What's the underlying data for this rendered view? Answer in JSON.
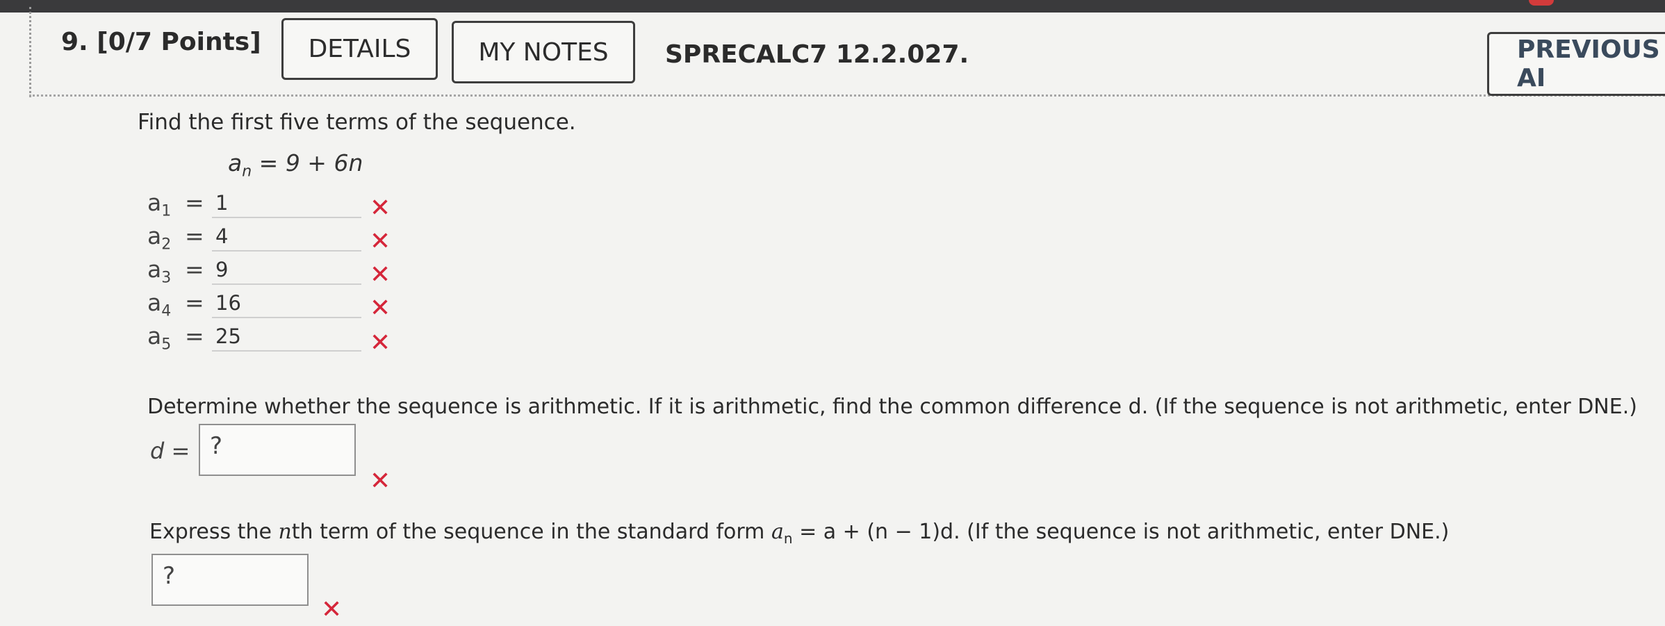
{
  "header": {
    "question_number": "9.",
    "points": "[0/7 Points]",
    "details_label": "DETAILS",
    "notes_label": "MY NOTES",
    "problem_code": "SPRECALC7 12.2.027.",
    "previous_label": "PREVIOUS AI"
  },
  "problem": {
    "prompt": "Find the first five terms of the sequence.",
    "formula_left": "a",
    "formula_sub": "n",
    "formula_right": " = 9 + 6n",
    "terms": [
      {
        "label": "a",
        "sub": "1",
        "value": "1"
      },
      {
        "label": "a",
        "sub": "2",
        "value": "4"
      },
      {
        "label": "a",
        "sub": "3",
        "value": "9"
      },
      {
        "label": "a",
        "sub": "4",
        "value": "16"
      },
      {
        "label": "a",
        "sub": "5",
        "value": "25"
      }
    ],
    "eq_sign": "=",
    "incorrect_mark": "✕"
  },
  "arithmetic": {
    "question": "Determine whether the sequence is arithmetic. If it is arithmetic, find the common difference d. (If the sequence is not arithmetic, enter DNE.)",
    "d_label": "d",
    "d_eq": " =",
    "d_value": "?"
  },
  "nth_term": {
    "question": "Express the nth term of the sequence in the standard form a_n = a + (n − 1)d. (If the sequence is not arithmetic, enter DNE.)",
    "q_part1": "Express the ",
    "q_n": "n",
    "q_part2": "th term of the sequence in the standard form  ",
    "q_formula": "a",
    "q_formula_sub": "n",
    "q_formula_rest": " = a + (n − 1)d.",
    "q_part3": "  (If the sequence is not arithmetic, enter DNE.)",
    "value": "?"
  },
  "colors": {
    "incorrect": "#d5263a",
    "border": "#3d3d3d"
  }
}
